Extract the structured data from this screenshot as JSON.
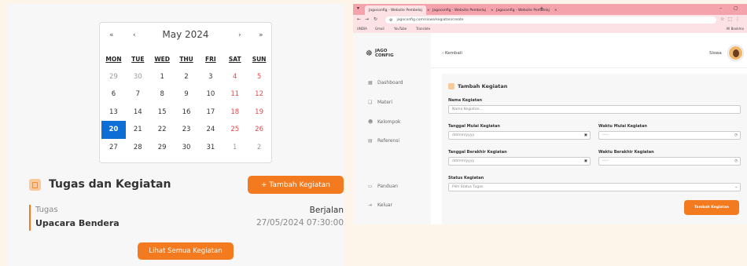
{
  "calendar": {
    "title": "May 2024",
    "nav": {
      "prev_year": "«",
      "prev_month": "‹",
      "next_month": "›",
      "next_year": "»"
    },
    "weekdays": [
      "MON",
      "TUE",
      "WED",
      "THU",
      "FRI",
      "SAT",
      "SUN"
    ],
    "weeks": [
      [
        "29",
        "30",
        "1",
        "2",
        "3",
        "4",
        "5"
      ],
      [
        "6",
        "7",
        "8",
        "9",
        "10",
        "11",
        "12"
      ],
      [
        "13",
        "14",
        "15",
        "16",
        "17",
        "18",
        "19"
      ],
      [
        "20",
        "21",
        "22",
        "23",
        "24",
        "25",
        "26"
      ],
      [
        "27",
        "28",
        "29",
        "30",
        "31",
        "1",
        "2"
      ]
    ],
    "selected_day": "20"
  },
  "tasks": {
    "title": "Tugas dan Kegiatan",
    "add_button": "+ Tambah Kegiatan",
    "item": {
      "type": "Tugas",
      "name": "Upacara Bendera",
      "status": "Berjalan",
      "datetime": "27/05/2024 07:30:00"
    },
    "see_all_button": "Lihat Semua Kegiatan"
  },
  "browser": {
    "tabs": [
      "Jagoconfig - Website Pembelaj",
      "Jagoconfig - Website Pembelaj",
      "Jagoconfig - Website Pembelaj"
    ],
    "url": "jagoconfig.com/siswa/kegiatan/create",
    "bookmarks": [
      "UNDIA",
      "Gmail",
      "YouTube",
      "Translate"
    ],
    "bookmarks_right": "All Bookma"
  },
  "app": {
    "logo_line1": "JAGO",
    "logo_line2": "CONFIG",
    "sidebar": [
      {
        "label": "Dashboard",
        "icon": "grid-icon"
      },
      {
        "label": "Materi",
        "icon": "book-icon"
      },
      {
        "label": "Kelompok",
        "icon": "users-icon"
      },
      {
        "label": "Referensi",
        "icon": "document-icon"
      },
      {
        "label": "Panduan",
        "icon": "guide-icon"
      },
      {
        "label": "Keluar",
        "icon": "logout-icon"
      }
    ],
    "back_label": "Kembali",
    "user_name": "Siswa"
  },
  "form": {
    "title": "Tambah Kegiatan",
    "name_label": "Nama Kegiatan",
    "name_placeholder": "Nama Kegiatan...",
    "start_date_label": "Tanggal Mulai Kegiatan",
    "start_date_placeholder": "dd/mm/yyyy",
    "start_time_label": "Waktu Mulai Kegiatan",
    "start_time_placeholder": "--:--",
    "end_date_label": "Tanggal Berakhir Kegiatan",
    "end_date_placeholder": "dd/mm/yyyy",
    "end_time_label": "Waktu Berakhir Kegiatan",
    "end_time_placeholder": "--:--",
    "status_label": "Status Kegiatan",
    "status_placeholder": "Pilih Status Tugas",
    "submit_label": "Tambah Kegiatan"
  },
  "colors": {
    "accent": "#f47a20",
    "selected_day": "#0d6fd6",
    "weekend": "#e24a4a",
    "tabbar": "#f4a2ab"
  }
}
